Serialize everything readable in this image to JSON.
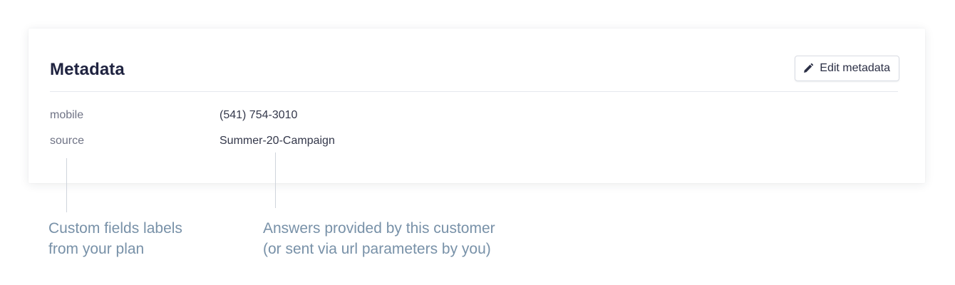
{
  "card": {
    "title": "Metadata",
    "edit_button": {
      "label": "Edit metadata",
      "icon": "pencil-icon"
    },
    "fields": [
      {
        "key": "mobile",
        "value": "(541) 754-3010"
      },
      {
        "key": "source",
        "value": "Summer-20-Campaign"
      }
    ]
  },
  "annotations": {
    "labels_note": [
      "Custom fields labels",
      "from your plan"
    ],
    "values_note": [
      "Answers provided by this customer",
      "(or sent via url parameters by you)"
    ]
  },
  "colors": {
    "title": "#1f2340",
    "key_text": "#6f7385",
    "value_text": "#33374a",
    "annotation_text": "#7891a8",
    "divider": "#e6e8ee"
  }
}
